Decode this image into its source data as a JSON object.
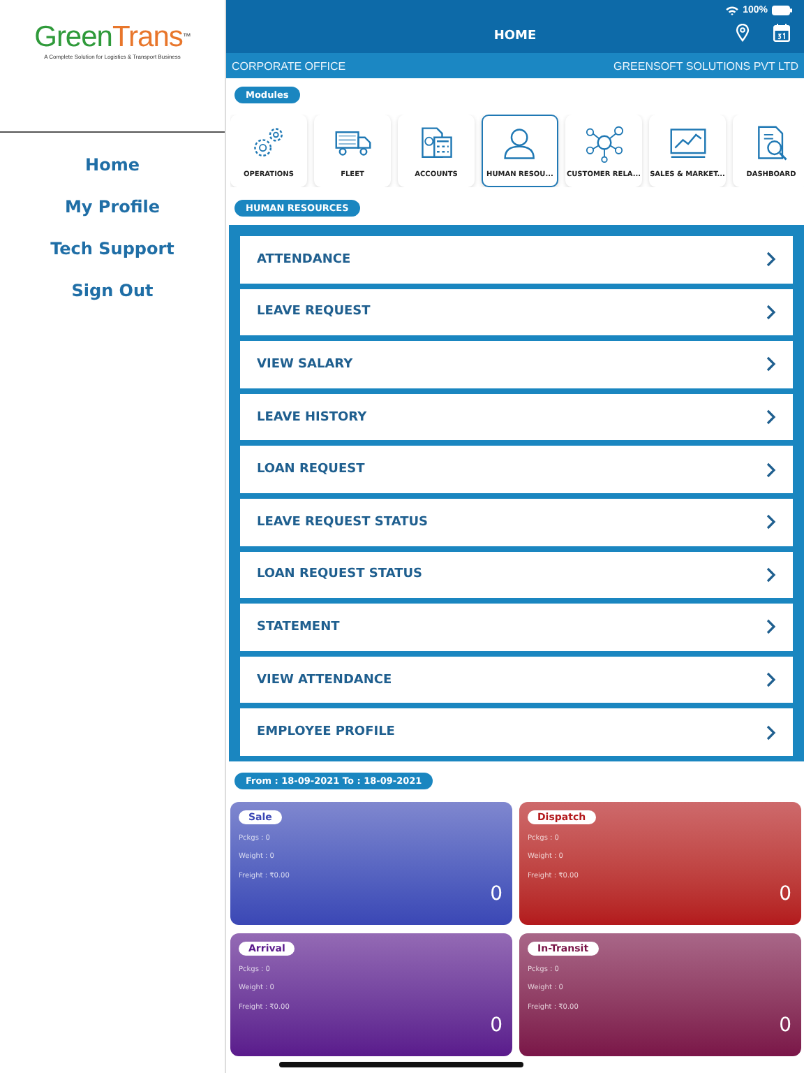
{
  "sidebar": {
    "logo": {
      "part_1": "Green",
      "part_2": "Trans",
      "mark": "™",
      "tagline": "A Complete Solution for Logistics & Transport Business"
    },
    "items": [
      {
        "label": "Home"
      },
      {
        "label": "My Profile"
      },
      {
        "label": "Tech Support"
      },
      {
        "label": "Sign Out"
      }
    ]
  },
  "status_bar": {
    "battery": "100%"
  },
  "header": {
    "title": "HOME",
    "branch": "CORPORATE OFFICE",
    "company": "GREENSOFT SOLUTIONS PVT LTD"
  },
  "modules": {
    "heading": "Modules",
    "items": [
      {
        "label": "OPERATIONS",
        "selected": false
      },
      {
        "label": "FLEET",
        "selected": false
      },
      {
        "label": "ACCOUNTS",
        "selected": false
      },
      {
        "label": "HUMAN RESOU...",
        "selected": true
      },
      {
        "label": "CUSTOMER RELA...",
        "selected": false
      },
      {
        "label": "SALES & MARKET...",
        "selected": false
      },
      {
        "label": "DASHBOARD",
        "selected": false
      }
    ]
  },
  "section": {
    "heading": "HUMAN RESOURCES",
    "items": [
      {
        "label": "ATTENDANCE"
      },
      {
        "label": "LEAVE REQUEST"
      },
      {
        "label": "VIEW SALARY"
      },
      {
        "label": "LEAVE HISTORY"
      },
      {
        "label": "LOAN REQUEST"
      },
      {
        "label": "LEAVE REQUEST STATUS"
      },
      {
        "label": "LOAN REQUEST STATUS"
      },
      {
        "label": "STATEMENT"
      },
      {
        "label": "VIEW ATTENDANCE"
      },
      {
        "label": "EMPLOYEE PROFILE"
      }
    ]
  },
  "summary": {
    "period": "From : 18-09-2021 To : 18-09-2021",
    "cards": [
      {
        "title": "Sale",
        "color": "#3b47b5",
        "lines": [
          "Pckgs : 0",
          "Weight : 0",
          "Freight : ₹0.00"
        ],
        "count": "0"
      },
      {
        "title": "Dispatch",
        "color": "#b3191c",
        "lines": [
          "Pckgs : 0",
          "Weight : 0",
          "Freight : ₹0.00"
        ],
        "count": "0"
      },
      {
        "title": "Arrival",
        "color": "#5a1a8c",
        "lines": [
          "Pckgs : 0",
          "Weight : 0",
          "Freight : ₹0.00"
        ],
        "count": "0"
      },
      {
        "title": "In-Transit",
        "color": "#7a1548",
        "lines": [
          "Pckgs : 0",
          "Weight : 0",
          "Freight : ₹0.00"
        ],
        "count": "0"
      }
    ]
  }
}
